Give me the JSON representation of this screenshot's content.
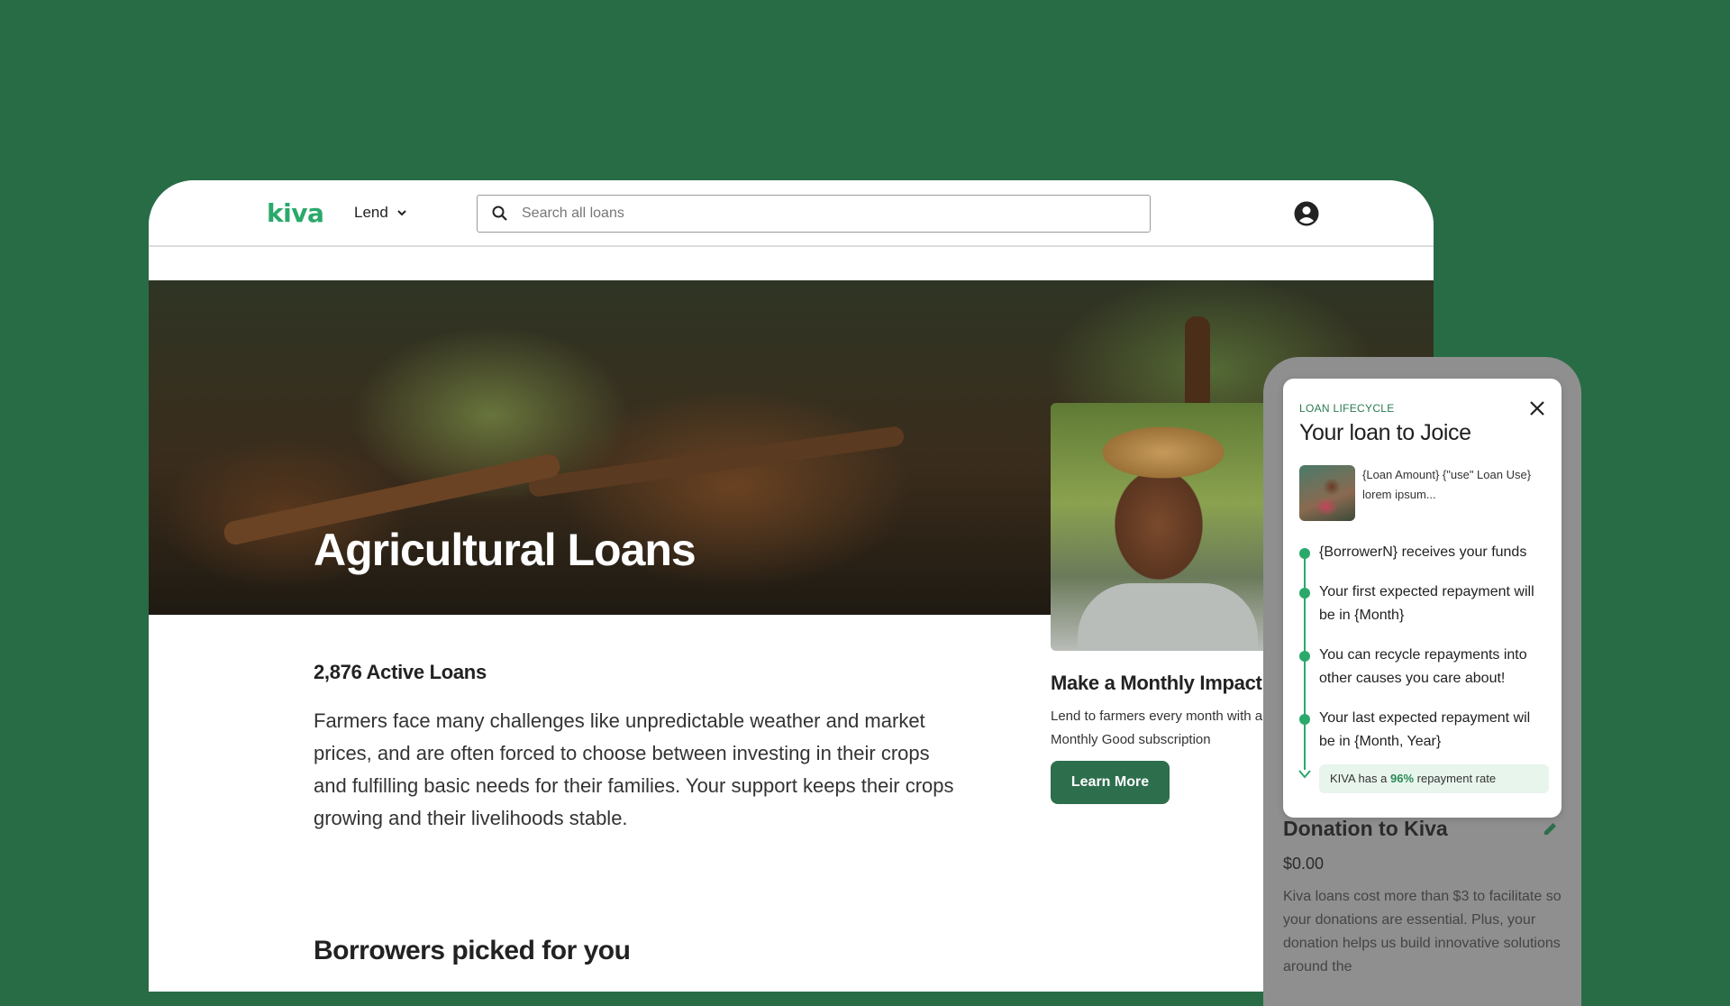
{
  "nav": {
    "logo": "kiva",
    "lend_label": "Lend",
    "search_placeholder": "Search all loans"
  },
  "hero": {
    "title": "Agricultural Loans"
  },
  "main": {
    "active_loans": "2,876 Active Loans",
    "description": "Farmers face many challenges like unpredictable weather and market prices, and are often forced to choose between investing in their crops and fulfilling basic needs for their families. Your support keeps their crops growing and their livelihoods stable.",
    "borrowers_heading": "Borrowers picked for you"
  },
  "promo": {
    "title": "Make a Monthly Impact",
    "text": "Lend to farmers every month with a Monthly Good subscription",
    "button": "Learn More"
  },
  "modal": {
    "label": "LOAN LIFECYCLE",
    "title": "Your loan to Joice",
    "loan_use": "{Loan Amount} {\"use\" Loan Use} lorem ipsum...",
    "timeline": [
      "{BorrowerN} receives your funds",
      "Your first expected repayment will be in {Month}",
      "You can recycle repayments into other causes you care about!",
      "Your last expected repayment wil be in {Month, Year}"
    ],
    "rate_prefix": "KIVA has a",
    "rate_value": "96%",
    "rate_suffix": "repayment rate"
  },
  "donation": {
    "title": "Donation to Kiva",
    "amount": "$0.00",
    "text": "Kiva loans cost more than $3 to facilitate so your donations are essential. Plus, your donation helps us build innovative solutions around the"
  },
  "colors": {
    "background": "#286c46",
    "brand_green": "#2aa96a",
    "button_green": "#2d6e4d"
  },
  "icons": [
    "search-icon",
    "chevron-down-icon",
    "account-icon",
    "close-icon",
    "edit-icon",
    "arrow-down-icon"
  ]
}
